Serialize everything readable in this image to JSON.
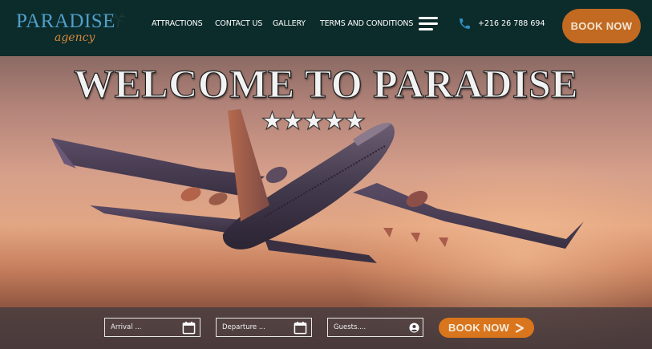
{
  "brand": {
    "name": "PARADISE",
    "tagline": "agency"
  },
  "nav": {
    "items": [
      {
        "label": "ATTRACTIONS"
      },
      {
        "label": "CONTACT US"
      },
      {
        "label": "GALLERY"
      },
      {
        "label": "TERMS AND CONDITIONS"
      }
    ]
  },
  "header": {
    "menu_icon": "hamburger-icon",
    "phone_icon": "phone-icon",
    "phone": "+216 26 788 694",
    "book_label": "BOOK NOW"
  },
  "hero": {
    "title": "WELCOME TO PARADISE",
    "rating_stars": "★★★★★",
    "rating": 5,
    "rating_max": 5
  },
  "booking": {
    "arrival_placeholder": "Arrival ...",
    "departure_placeholder": "Departure ...",
    "guests_placeholder": "Guests....",
    "calendar_icon": "calendar-icon",
    "guests_icon": "user-circle-icon",
    "submit_label": "BOOK NOW",
    "submit_icon": "chevron-right-icon"
  },
  "colors": {
    "header_bg": "#0c2b2b",
    "brand_blue": "#4f9fc9",
    "brand_orange": "#d38a3b",
    "accent_orange": "#d9751c",
    "phone_blue": "#2f8fc4"
  }
}
